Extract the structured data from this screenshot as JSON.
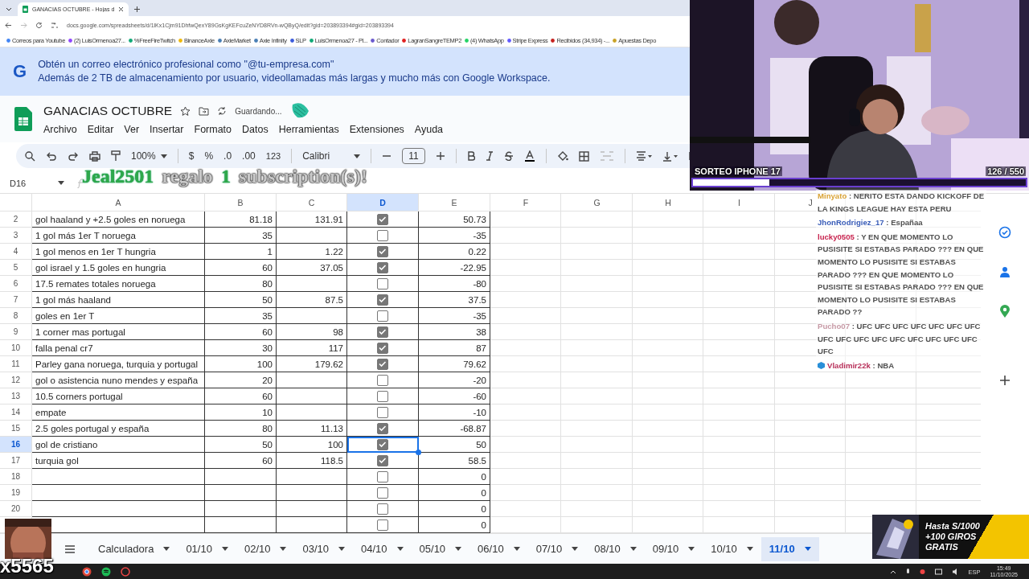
{
  "browser": {
    "tab_title": "GANACIAS OCTUBRE - Hojas d",
    "url": "docs.google.com/spreadsheets/d/1lKx1Cjm91DhfwQexY89GsKgKEFcuZeNYD8RVn-wQByQ/edit?gid=203893394#gid=203893394",
    "bookmarks": [
      "Correos para Youtube",
      "(2) LuisOrmenoa27...",
      "%FreeFireTwitch",
      "BinanceAxie",
      "AxieMarket",
      "Axie Infinity",
      "SLP",
      "LuisOrmenoa27 - Pl...",
      "Contador",
      "LagranSangreTEMP2",
      "(4) WhatsApp",
      "Stripe Express",
      "Recibidos (34,934) -...",
      "Apuestas Depo"
    ]
  },
  "banner": {
    "logo": "G",
    "title": "Obtén un correo electrónico profesional como \"@tu-empresa.com\"",
    "subtitle": "Además de 2 TB de almacenamiento por usuario, videollamadas más largas y mucho más con Google Workspace."
  },
  "document": {
    "title": "GANACIAS OCTUBRE",
    "status": "Guardando...",
    "menus": [
      "Archivo",
      "Editar",
      "Ver",
      "Insertar",
      "Formato",
      "Datos",
      "Herramientas",
      "Extensiones",
      "Ayuda"
    ]
  },
  "toolbar": {
    "zoom": "100%",
    "currency": "$",
    "percent": "%",
    "decrease_decimals": ".0",
    "increase_decimals": ".00",
    "number_format": "123",
    "font": "Calibri",
    "font_size": "11"
  },
  "formula_bar": {
    "name_box": "D16"
  },
  "columns": [
    {
      "label": "A",
      "selected": false
    },
    {
      "label": "B",
      "selected": false
    },
    {
      "label": "C",
      "selected": false
    },
    {
      "label": "D",
      "selected": true
    },
    {
      "label": "E",
      "selected": false
    },
    {
      "label": "F",
      "selected": false
    },
    {
      "label": "G",
      "selected": false
    },
    {
      "label": "H",
      "selected": false
    },
    {
      "label": "I",
      "selected": false
    },
    {
      "label": "J",
      "selected": false
    }
  ],
  "rows": [
    {
      "num": "2",
      "a": "gol haaland y +2.5 goles en noruega",
      "b": "81.18",
      "c": "131.91",
      "checked": true,
      "e": "50.73",
      "selected": false
    },
    {
      "num": "3",
      "a": "1 gol más 1er T noruega",
      "b": "35",
      "checked": false,
      "e": "-35",
      "selected": false
    },
    {
      "num": "4",
      "a": "1 gol menos en 1er T hungria",
      "b": "1",
      "c": "1.22",
      "checked": true,
      "e": "0.22",
      "selected": false
    },
    {
      "num": "5",
      "a": "gol israel y 1.5 goles en hungria",
      "b": "60",
      "c": "37.05",
      "checked": true,
      "e": "-22.95",
      "selected": false
    },
    {
      "num": "6",
      "a": "17.5 remates totales noruega",
      "b": "80",
      "checked": false,
      "e": "-80",
      "selected": false
    },
    {
      "num": "7",
      "a": "1 gol más haaland",
      "b": "50",
      "c": "87.5",
      "checked": true,
      "e": "37.5",
      "selected": false
    },
    {
      "num": "8",
      "a": "goles en 1er T",
      "b": "35",
      "checked": false,
      "e": "-35",
      "selected": false
    },
    {
      "num": "9",
      "a": "1 corner mas portugal",
      "b": "60",
      "c": "98",
      "checked": true,
      "e": "38",
      "selected": false
    },
    {
      "num": "10",
      "a": "falla penal cr7",
      "b": "30",
      "c": "117",
      "checked": true,
      "e": "87",
      "selected": false
    },
    {
      "num": "11",
      "a": "Parley gana noruega, turquia y portugal",
      "b": "100",
      "c": "179.62",
      "checked": true,
      "e": "79.62",
      "selected": false
    },
    {
      "num": "12",
      "a": "gol o asistencia nuno mendes y españa",
      "b": "20",
      "checked": false,
      "e": "-20",
      "selected": false
    },
    {
      "num": "13",
      "a": "10.5 corners portugal",
      "b": "60",
      "checked": false,
      "e": "-60",
      "selected": false
    },
    {
      "num": "14",
      "a": "empate",
      "b": "10",
      "checked": false,
      "e": "-10",
      "selected": false
    },
    {
      "num": "15",
      "a": "2.5 goles portugal y españa",
      "b": "80",
      "c": "11.13",
      "checked": true,
      "e": "-68.87",
      "selected": false
    },
    {
      "num": "16",
      "a": "gol de cristiano",
      "b": "50",
      "c": "100",
      "checked": true,
      "e": "50",
      "selected": true
    },
    {
      "num": "17",
      "a": "turquia gol",
      "b": "60",
      "c": "118.5",
      "checked": true,
      "e": "58.5",
      "selected": false
    },
    {
      "num": "18",
      "checked": false,
      "e": "0",
      "selected": false
    },
    {
      "num": "19",
      "checked": false,
      "e": "0",
      "selected": false
    },
    {
      "num": "20",
      "checked": false,
      "e": "0",
      "selected": false
    },
    {
      "checked": false,
      "e": "0",
      "selected": false
    }
  ],
  "sheet_tabs": [
    {
      "label": "Calculadora",
      "selected": false
    },
    {
      "label": "01/10",
      "selected": false
    },
    {
      "label": "02/10",
      "selected": false
    },
    {
      "label": "03/10",
      "selected": false
    },
    {
      "label": "04/10",
      "selected": false
    },
    {
      "label": "05/10",
      "selected": false
    },
    {
      "label": "06/10",
      "selected": false
    },
    {
      "label": "07/10",
      "selected": false
    },
    {
      "label": "08/10",
      "selected": false
    },
    {
      "label": "09/10",
      "selected": false
    },
    {
      "label": "10/10",
      "selected": false
    },
    {
      "label": "11/10",
      "selected": true
    }
  ],
  "taskbar": {
    "language": "ESP",
    "time": "15:49",
    "date": "11/10/2025"
  },
  "webcam": {
    "title": "SORTEO IPHONE 17",
    "count": "126 / 550",
    "level": 0.23
  },
  "chat": [
    {
      "user": "Minyato",
      "color": "#d9a336",
      "text": ": NERITO ESTA DANDO KICKOFF DE LA KINGS LEAGUE HAY ESTA PERU"
    },
    {
      "user": "JhonRodrigiez_17",
      "color": "#3a5db8",
      "text": ": Españaa"
    },
    {
      "user": "lucky0505",
      "color": "#c8244f",
      "text": ": Y EN QUE MOMENTO LO PUSISITE SI ESTABAS PARADO ??? EN QUE MOMENTO LO PUSISITE SI ESTABAS PARADO ??? EN QUE MOMENTO LO PUSISITE SI ESTABAS PARADO ??? EN QUE MOMENTO LO PUSISITE SI ESTABAS PARADO ??"
    },
    {
      "user": "Pucho07",
      "color": "#c79aa6",
      "text": ": UFC UFC UFC UFC UFC UFC UFC UFC UFC UFC UFC UFC UFC UFC UFC UFC UFC"
    },
    {
      "user": "Vladimir22k",
      "color": "#b8305a",
      "badge": true,
      "text": ": NBA"
    }
  ],
  "sub_alert": {
    "parts": [
      {
        "text": "Jeal2501",
        "highlight": true
      },
      {
        "text": "regalo",
        "highlight": false
      },
      {
        "text": "1",
        "highlight": true
      },
      {
        "text": "subscription(s)!",
        "highlight": false
      }
    ]
  },
  "meme": {
    "label": "x5565"
  },
  "ad": {
    "lines": [
      "Hasta S/1000",
      "+100 GIROS",
      "GRATIS"
    ]
  }
}
